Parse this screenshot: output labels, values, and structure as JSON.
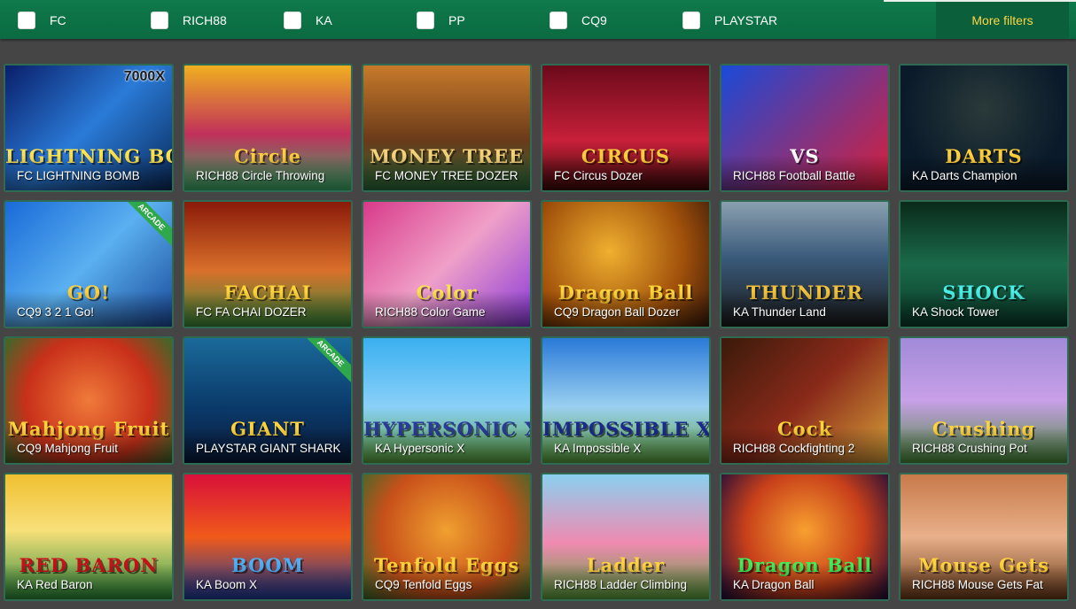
{
  "filters": [
    {
      "label": "FC",
      "checked": false
    },
    {
      "label": "RICH88",
      "checked": false
    },
    {
      "label": "KA",
      "checked": false
    },
    {
      "label": "PP",
      "checked": false
    },
    {
      "label": "CQ9",
      "checked": false
    },
    {
      "label": "PLAYSTAR",
      "checked": false
    }
  ],
  "more_filters_label": "More filters",
  "colors": {
    "bar": "#0f7a4c",
    "more_filters_bg": "#0b5f3a",
    "more_filters_text": "#ffd642",
    "page_bg": "#454545",
    "tile_border": "#2f6a52"
  },
  "games": [
    {
      "label": "FC LIGHTNING BOMB",
      "art_text": "LIGHTNING BOMB",
      "extra": "7000X",
      "bg": "linear-gradient(135deg,#0a1f6a,#2a7bd8 50%,#0a2a5a)",
      "art_color": "#ffe24a"
    },
    {
      "label": "RICH88 Circle Throwing",
      "art_text": "Circle",
      "extra": "",
      "bg": "linear-gradient(#f0b020,#c0305a 55%,#3ab06a)",
      "art_color": "#ffcf3a"
    },
    {
      "label": "FC MONEY TREE DOZER",
      "art_text": "MONEY TREE",
      "extra": "",
      "bg": "linear-gradient(#c87a2a,#6a3a1a 60%,#2a6a3a)",
      "art_color": "#f3d27a"
    },
    {
      "label": "FC Circus Dozer",
      "art_text": "CIRCUS",
      "extra": "",
      "bg": "linear-gradient(#6a0a1a,#c8203a 60%,#3a0a0a)",
      "art_color": "#ffcf3a"
    },
    {
      "label": "RICH88 Football Battle",
      "art_text": "VS",
      "extra": "",
      "bg": "linear-gradient(135deg,#1a4ad8,#d8203a)",
      "art_color": "#ffffff"
    },
    {
      "label": "KA Darts Champion",
      "art_text": "DARTS",
      "extra": "",
      "bg": "radial-gradient(circle at 50% 35%,#2a3a3a,#0a1a2a 70%)",
      "art_color": "#ffcf3a"
    },
    {
      "label": "CQ9 3 2 1 Go!",
      "art_text": "GO!",
      "extra": "",
      "badge": "ARCADE",
      "bg": "linear-gradient(135deg,#1a6ad8,#5ab0f0 50%,#1a4a9a)",
      "art_color": "#ffcf3a"
    },
    {
      "label": "FC FA CHAI DOZER",
      "art_text": "FACHAI",
      "extra": "",
      "bg": "linear-gradient(#8a1a0a,#d8702a 55%,#3a8a3a)",
      "art_color": "#ffd33a"
    },
    {
      "label": "RICH88 Color Game",
      "art_text": "Color",
      "extra": "",
      "bg": "linear-gradient(135deg,#d83a8a,#f0a0c8 50%,#8a3ad8)",
      "art_color": "#ffe24a"
    },
    {
      "label": "CQ9 Dragon Ball Dozer",
      "art_text": "Dragon Ball",
      "extra": "",
      "bg": "radial-gradient(circle at 40% 40%,#f0b030,#a0500a 60%,#3a1a0a)",
      "art_color": "#ffd33a"
    },
    {
      "label": "KA Thunder Land",
      "art_text": "THUNDER",
      "extra": "",
      "bg": "linear-gradient(#8aa0b0,#3a5a7a 45%,#1a1a1a)",
      "art_color": "#f3c23a"
    },
    {
      "label": "KA Shock Tower",
      "art_text": "SHOCK",
      "extra": "",
      "bg": "linear-gradient(#0a2a1a,#1a6a4a 50%,#0a3a2a)",
      "art_color": "#4af0e8"
    },
    {
      "label": "CQ9 Mahjong Fruit",
      "art_text": "Mahjong Fruit",
      "extra": "",
      "bg": "radial-gradient(circle at 50% 50%,#f07a3a,#c8301a 60%,#3a6a2a)",
      "art_color": "#ffd33a"
    },
    {
      "label": "PLAYSTAR GIANT SHARK",
      "art_text": "GIANT",
      "extra": "",
      "badge": "ARCADE",
      "bg": "linear-gradient(#1a6a9a,#0a3a6a 55%,#0a1a3a)",
      "art_color": "#ffd33a"
    },
    {
      "label": "KA Hypersonic X",
      "art_text": "HYPERSONIC X",
      "extra": "",
      "bg": "linear-gradient(#3ab0f0,#8ad0f8 55%,#5aa03a)",
      "art_color": "#2a3a9a"
    },
    {
      "label": "KA Impossible X",
      "art_text": "IMPOSSIBLE X",
      "extra": "",
      "bg": "linear-gradient(#2a7ad8,#9ad0f0 55%,#5aa03a)",
      "art_color": "#1a2a8a"
    },
    {
      "label": "RICH88 Cockfighting 2",
      "art_text": "Cock",
      "extra": "",
      "bg": "linear-gradient(135deg,#3a1a0a,#8a2a1a 50%,#d8a03a)",
      "art_color": "#ffd33a"
    },
    {
      "label": "RICH88 Crushing Pot",
      "art_text": "Crushing",
      "extra": "",
      "bg": "linear-gradient(#a08ad8,#c8a0e8 50%,#4a8a3a)",
      "art_color": "#ffd33a"
    },
    {
      "label": "KA Red Baron",
      "art_text": "RED BARON",
      "extra": "",
      "bg": "linear-gradient(#f0c030,#f8e07a 45%,#2a8a3a)",
      "art_color": "#c8101a"
    },
    {
      "label": "KA Boom X",
      "art_text": "BOOM",
      "extra": "",
      "bg": "linear-gradient(#d8103a,#f05a1a 50%,#1a3a9a)",
      "art_color": "#4ab0f8"
    },
    {
      "label": "CQ9 Tenfold Eggs",
      "art_text": "Tenfold Eggs",
      "extra": "",
      "bg": "radial-gradient(circle at 50% 45%,#f0a030,#c8501a 60%,#3a6a2a)",
      "art_color": "#ffd33a"
    },
    {
      "label": "RICH88 Ladder Climbing",
      "art_text": "Ladder",
      "extra": "",
      "bg": "linear-gradient(#8ad0f0,#f08ab0 55%,#5aa03a)",
      "art_color": "#ffd33a"
    },
    {
      "label": "KA Dragon Ball",
      "art_text": "Dragon Ball",
      "extra": "",
      "bg": "radial-gradient(circle at 50% 45%,#f8a030,#c8401a 55%,#1a0a3a)",
      "art_color": "#3af05a"
    },
    {
      "label": "RICH88 Mouse Gets Fat",
      "art_text": "Mouse Gets",
      "extra": "",
      "bg": "linear-gradient(#c87a4a,#e8b08a 50%,#6a3a1a)",
      "art_color": "#ffd33a"
    }
  ]
}
